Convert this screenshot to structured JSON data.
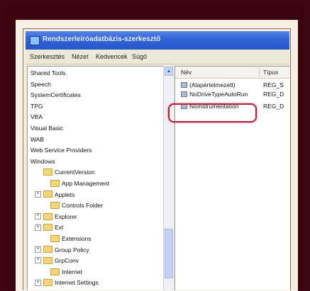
{
  "window": {
    "title": "Rendszerleíróadatbázis-szerkesztő"
  },
  "menu": [
    "Szerkesztés",
    "Nézet",
    "Kedvencek",
    "Súgó"
  ],
  "tree": {
    "items": [
      {
        "label": "Shared Tools",
        "expander": "",
        "folder": false
      },
      {
        "label": "Speech",
        "expander": "",
        "folder": false
      },
      {
        "label": "SystemCertificates",
        "expander": "",
        "folder": false
      },
      {
        "label": "TPG",
        "expander": "",
        "folder": false
      },
      {
        "label": "VBA",
        "expander": "",
        "folder": false
      },
      {
        "label": "Visual Basic",
        "expander": "",
        "folder": false
      },
      {
        "label": "WAB",
        "expander": "",
        "folder": false
      },
      {
        "label": "Web Service Providers",
        "expander": "",
        "folder": false
      },
      {
        "label": "Windows",
        "expander": "",
        "folder": false
      },
      {
        "label": "CurrentVersion",
        "expander": "",
        "folder": true
      },
      {
        "label": "App Management",
        "expander": "",
        "folder": true
      },
      {
        "label": "Applets",
        "expander": "+",
        "folder": true
      },
      {
        "label": "Controls Folder",
        "expander": "",
        "folder": true
      },
      {
        "label": "Explorer",
        "expander": "+",
        "folder": true
      },
      {
        "label": "Ext",
        "expander": "+",
        "folder": true
      },
      {
        "label": "Extensions",
        "expander": "",
        "folder": true
      },
      {
        "label": "Group Policy",
        "expander": "+",
        "folder": true
      },
      {
        "label": "GrpConv",
        "expander": "+",
        "folder": true
      },
      {
        "label": "Internet",
        "expander": "",
        "folder": true
      },
      {
        "label": "Internet Settings",
        "expander": "+",
        "folder": true
      }
    ]
  },
  "list": {
    "columns": {
      "name": "Név",
      "type": "Típus"
    },
    "rows": [
      {
        "name": "(Alapértelmezett)",
        "type": "REG_S"
      },
      {
        "name": "NoDriveTypeAutoRun",
        "type": "REG_D"
      },
      {
        "name": "NoInstrumentation",
        "type": "REG_D"
      }
    ]
  },
  "colors": {
    "photo_background": "#3d0611",
    "highlight": "#b5203c",
    "titlebar": "#3465d5"
  }
}
